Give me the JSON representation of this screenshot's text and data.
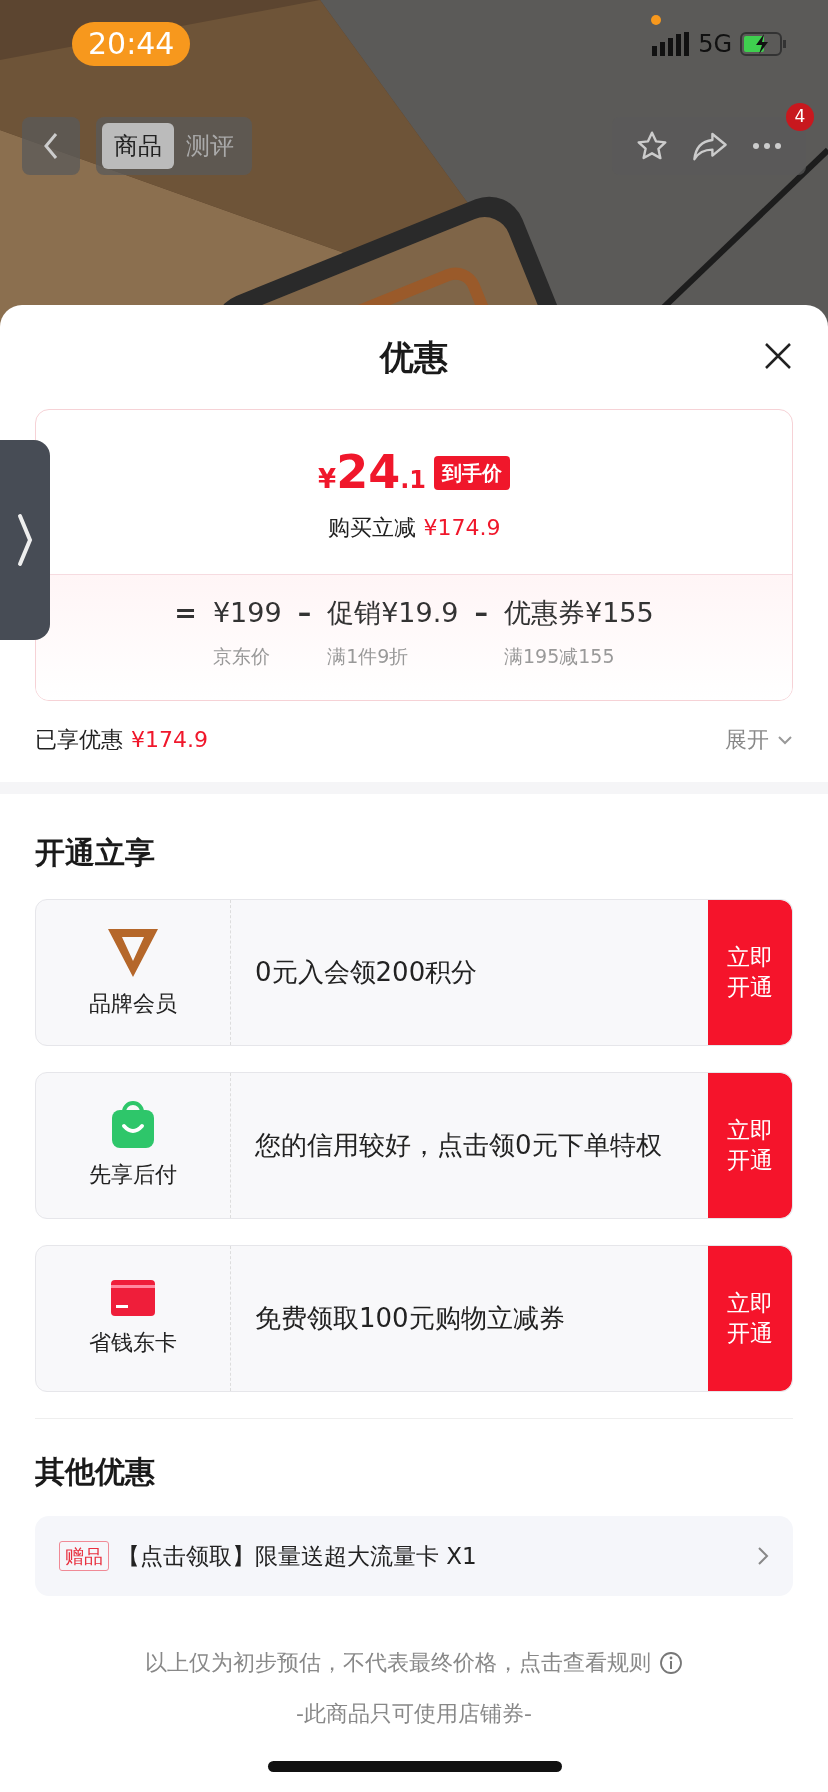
{
  "status_bar": {
    "time": "20:44",
    "network": "5G"
  },
  "nav": {
    "tabs": [
      {
        "label": "商品",
        "selected": true
      },
      {
        "label": "测评",
        "selected": false
      }
    ],
    "badge": "4"
  },
  "sheet": {
    "title": "优惠",
    "price": {
      "symbol": "¥",
      "integer": "24",
      "decimal": ".1",
      "tag": "到手价"
    },
    "savings": {
      "label": "购买立减",
      "amount": "¥174.9"
    },
    "breakdown": [
      {
        "sign": "=",
        "value": "¥199",
        "note": "京东价"
      },
      {
        "sign": "–",
        "label": "促销",
        "value": "¥19.9",
        "note": "满1件9折"
      },
      {
        "sign": "–",
        "label": "优惠券",
        "value": "¥155",
        "note": "满195减155"
      }
    ],
    "enjoyed": {
      "label": "已享优惠",
      "amount": "¥174.9"
    },
    "expand": "展开"
  },
  "members": {
    "title": "开通立享",
    "items": [
      {
        "kind": "brand",
        "name": "品牌会员",
        "description": "0元入会领200积分",
        "action": "立即开通"
      },
      {
        "kind": "paylater",
        "name": "先享后付",
        "description": "您的信用较好，点击领0元下单特权",
        "action": "立即开通"
      },
      {
        "kind": "card",
        "name": "省钱东卡",
        "description": "免费领取100元购物立减券",
        "action": "立即开通"
      }
    ]
  },
  "others": {
    "title": "其他优惠",
    "items": [
      {
        "tag": "赠品",
        "text": "【点击领取】限量送超大流量卡 X1"
      }
    ]
  },
  "footer": {
    "notice": "以上仅为初步预估，不代表最终价格，点击查看规则",
    "rule": "-此商品只可使用店铺券-"
  }
}
